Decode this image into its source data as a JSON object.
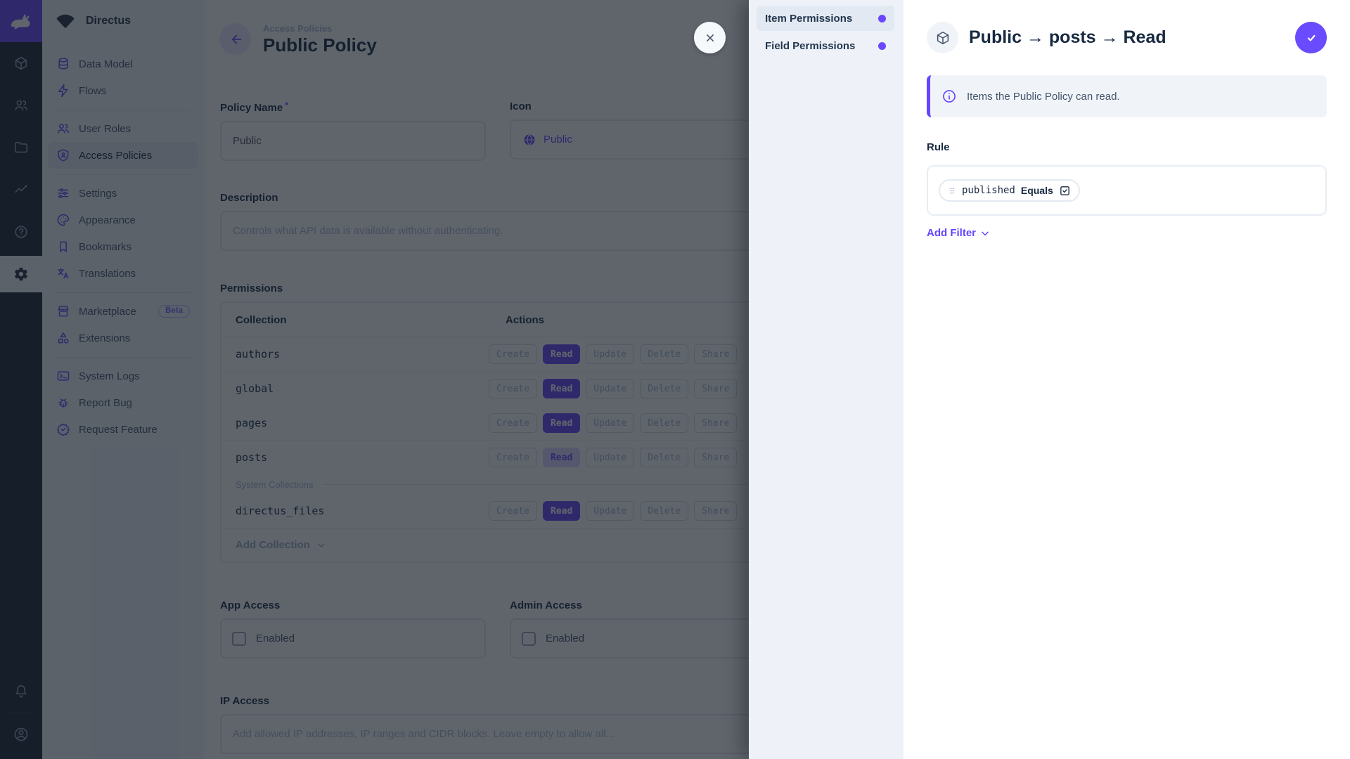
{
  "colors": {
    "primary": "#6644FF",
    "module_bar_bg": "#18222F",
    "nav_bg": "#F0F4F9",
    "heading": "#172940"
  },
  "module_bar": {
    "logo": "directus-rabbit",
    "modules": [
      "content",
      "user-directory",
      "file-library",
      "insights",
      "documentation",
      "settings"
    ],
    "active_module": "settings",
    "bottom": [
      "notifications",
      "account"
    ]
  },
  "sidebar": {
    "project_name": "Directus",
    "items": [
      {
        "label": "Data Model",
        "icon": "database"
      },
      {
        "label": "Flows",
        "icon": "bolt"
      },
      {
        "label": "User Roles",
        "icon": "people"
      },
      {
        "label": "Access Policies",
        "icon": "admin-shield",
        "active": true
      },
      {
        "label": "Settings",
        "icon": "tune"
      },
      {
        "label": "Appearance",
        "icon": "palette"
      },
      {
        "label": "Bookmarks",
        "icon": "bookmark"
      },
      {
        "label": "Translations",
        "icon": "translate"
      },
      {
        "label": "Marketplace",
        "icon": "storefront",
        "badge": "Beta"
      },
      {
        "label": "Extensions",
        "icon": "category"
      },
      {
        "label": "System Logs",
        "icon": "terminal"
      },
      {
        "label": "Report Bug",
        "icon": "bug"
      },
      {
        "label": "Request Feature",
        "icon": "new-releases"
      }
    ]
  },
  "main": {
    "breadcrumb": "Access Policies",
    "title": "Public Policy",
    "fields": {
      "policy_name": {
        "label": "Policy Name",
        "required": "*",
        "value": "Public"
      },
      "icon": {
        "label": "Icon",
        "value": "Public"
      },
      "description": {
        "label": "Description",
        "placeholder": "Controls what API data is available without authenticating."
      },
      "app_access": {
        "label": "App Access",
        "checkbox_label": "Enabled",
        "checked": false
      },
      "admin_access": {
        "label": "Admin Access",
        "checkbox_label": "Enabled",
        "checked": false
      },
      "ip_access": {
        "label": "IP Access",
        "placeholder": "Add allowed IP addresses, IP ranges and CIDR blocks. Leave empty to allow all..."
      }
    },
    "permissions": {
      "label": "Permissions",
      "columns": {
        "collection": "Collection",
        "actions": "Actions"
      },
      "action_labels": [
        "Create",
        "Read",
        "Update",
        "Delete",
        "Share"
      ],
      "rows": [
        {
          "name": "authors",
          "granted": [
            "Read"
          ]
        },
        {
          "name": "global",
          "granted": [
            "Read"
          ]
        },
        {
          "name": "pages",
          "granted": [
            "Read"
          ]
        },
        {
          "name": "posts",
          "granted": [
            "Read"
          ],
          "state": "open-in-editor"
        }
      ],
      "system_divider": "System Collections",
      "system_rows": [
        {
          "name": "directus_files",
          "granted": [
            "Read"
          ]
        }
      ],
      "add_collection_label": "Add Collection"
    }
  },
  "drawer": {
    "tabs": [
      {
        "label": "Item Permissions",
        "active": true
      },
      {
        "label": "Field Permissions",
        "active": false
      }
    ],
    "title": "Public → posts → Read",
    "info_text": "Items the Public Policy can read.",
    "rule_label": "Rule",
    "filter": {
      "field": "published",
      "operator": "Equals",
      "value_checked": true
    },
    "add_filter_label": "Add Filter"
  }
}
